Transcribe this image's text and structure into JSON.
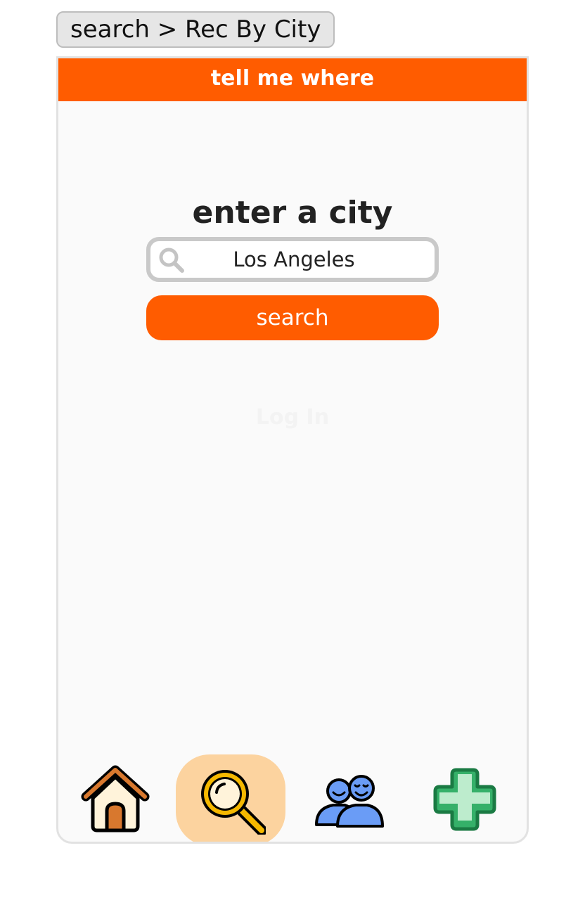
{
  "breadcrumb": {
    "text": "search > Rec By City"
  },
  "header": {
    "title": "tell me where"
  },
  "main": {
    "heading": "enter a city",
    "search": {
      "value": "Los Angeles",
      "icon": "search-icon"
    },
    "search_button_label": "search",
    "login_label": "Log In"
  },
  "nav": {
    "items": [
      {
        "icon": "home-icon",
        "active": false
      },
      {
        "icon": "magnifier-icon",
        "active": true
      },
      {
        "icon": "people-icon",
        "active": false
      },
      {
        "icon": "plus-icon",
        "active": false
      }
    ]
  },
  "colors": {
    "accent": "#ff5c00",
    "active_nav_bg": "#fcd39f",
    "panel_bg": "#fafafa"
  }
}
